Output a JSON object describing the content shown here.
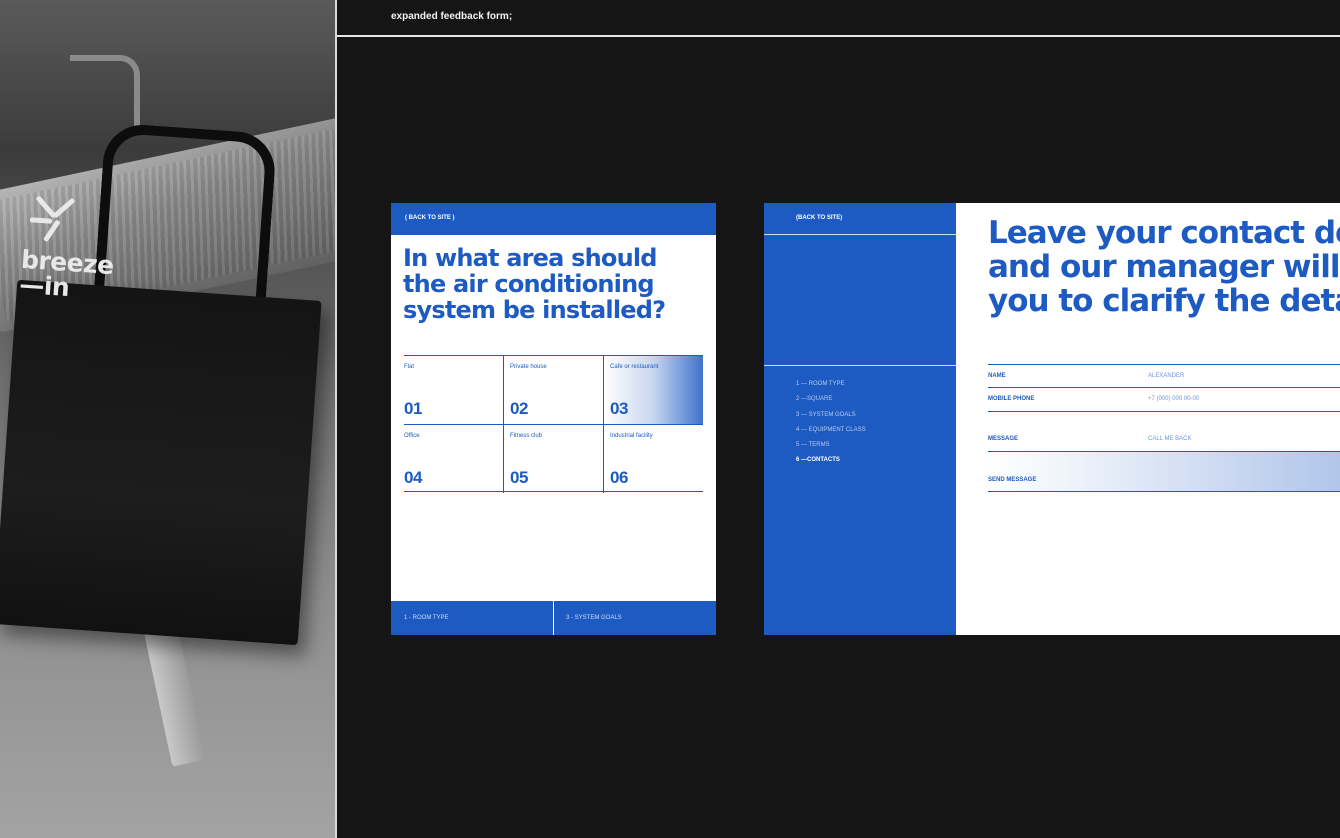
{
  "header": {
    "title": "expanded feedback form;"
  },
  "photo": {
    "brand_line1": "breeze",
    "brand_line2": "—in"
  },
  "card1": {
    "back_label": "( BACK TO SITE )",
    "title": "In what area should the air conditioning system be installed?",
    "options": [
      {
        "label": "Flat",
        "number": "01"
      },
      {
        "label": "Private house",
        "number": "02"
      },
      {
        "label": "Cafe or restaurant",
        "number": "03",
        "highlighted": true
      },
      {
        "label": "Office",
        "number": "04"
      },
      {
        "label": "Fitness club",
        "number": "05"
      },
      {
        "label": "Industrial facility",
        "number": "06"
      }
    ],
    "footer": {
      "prev": "1 - ROOM TYPE",
      "next": "3 - SYSTEM GOALS"
    }
  },
  "card2": {
    "back_label": "(BACK TO SITE)",
    "steps": [
      {
        "label": "1 — ROOM TYPE",
        "active": false
      },
      {
        "label": "2 —SQUARE",
        "active": false
      },
      {
        "label": "3 — SYSTEM GOALS",
        "active": false
      },
      {
        "label": "4 — EQUIPMENT CLASS",
        "active": false
      },
      {
        "label": "5 — TERMS",
        "active": false
      },
      {
        "label": "6 —CONTACTS",
        "active": true
      }
    ],
    "title_lines": [
      "Leave your contact de",
      "and our manager will c",
      "you to clarify the deta"
    ],
    "form": {
      "name_label": "NAME",
      "name_value": "ALEXANDER",
      "phone_label": "MOBILE PHONE",
      "phone_value": "+7 (000) 000 00-00",
      "message_label": "MESSAGE",
      "message_value": "CALL ME BACK",
      "send_label": "SEND MESSAGE"
    }
  },
  "colors": {
    "accent": "#1d5bc2",
    "background": "#151515",
    "card": "#ffffff"
  }
}
